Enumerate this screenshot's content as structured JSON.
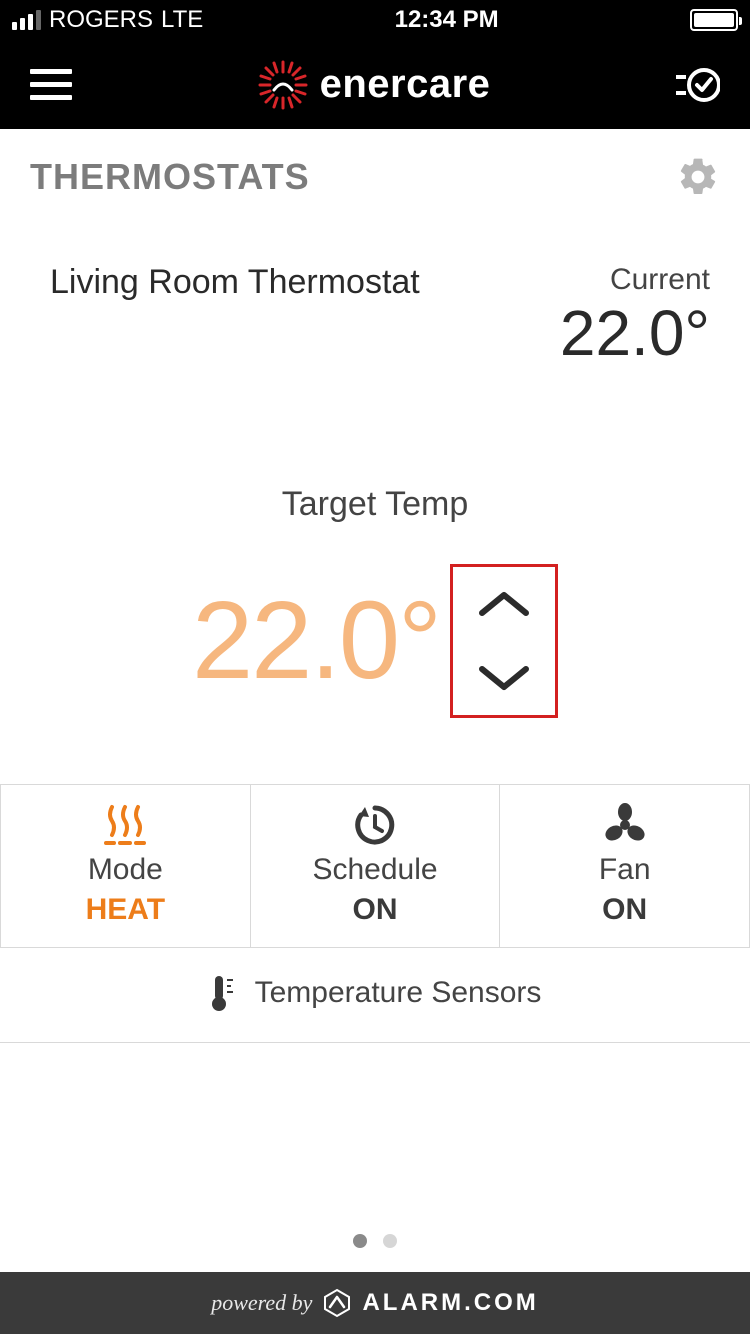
{
  "status_bar": {
    "carrier": "ROGERS",
    "network": "LTE",
    "time": "12:34 PM"
  },
  "header": {
    "brand": "enercare"
  },
  "section": {
    "title": "THERMOSTATS"
  },
  "device": {
    "name": "Living Room Thermostat",
    "current_label": "Current",
    "current_temp": "22.0°"
  },
  "target": {
    "label": "Target Temp",
    "value": "22.0°"
  },
  "controls": {
    "mode": {
      "title": "Mode",
      "value": "HEAT"
    },
    "schedule": {
      "title": "Schedule",
      "value": "ON"
    },
    "fan": {
      "title": "Fan",
      "value": "ON"
    }
  },
  "sensors": {
    "label": "Temperature Sensors"
  },
  "footer": {
    "powered_by": "powered by",
    "brand": "ALARM.COM"
  }
}
